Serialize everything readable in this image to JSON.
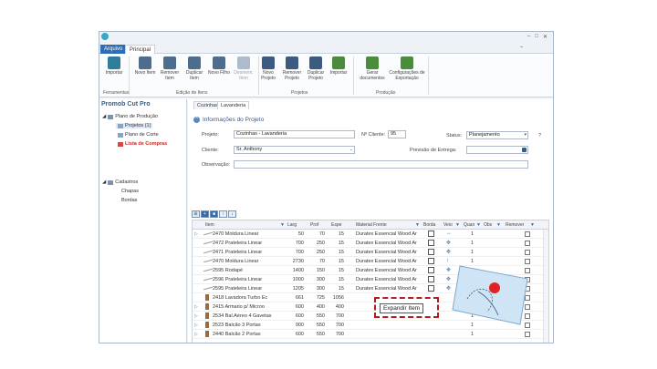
{
  "titlebar": {
    "file_tab": "Arquivo",
    "main_tab": "Principal"
  },
  "ribbon": {
    "buttons": [
      {
        "label": "Importar",
        "icon": "import-icon"
      },
      {
        "label": "Novo Item",
        "icon": "new-item-icon"
      },
      {
        "label": "Remover Item",
        "icon": "remove-item-icon"
      },
      {
        "label": "Duplicar Item",
        "icon": "duplicate-item-icon"
      },
      {
        "label": "Novo Filho",
        "icon": "new-child-icon"
      },
      {
        "label": "Desmem. Item",
        "icon": "split-item-icon"
      },
      {
        "label": "Novo Projeto",
        "icon": "new-project-icon"
      },
      {
        "label": "Remover Projeto",
        "icon": "remove-project-icon"
      },
      {
        "label": "Duplicar Projeto",
        "icon": "duplicate-project-icon"
      },
      {
        "label": "Importar",
        "icon": "import-project-icon"
      },
      {
        "label": "Gerar documentos",
        "icon": "generate-docs-icon"
      },
      {
        "label": "Configurações de Exportação",
        "icon": "export-settings-icon"
      }
    ],
    "groups": [
      "Ferramentas",
      "Edição de Itens",
      "Projetos",
      "Produção"
    ]
  },
  "left_panel": {
    "title": "Promob Cut Pro",
    "tree": {
      "plan": "Plano de Produção",
      "projects": "Projetos (1)",
      "cut_plan": "Plano de Corte",
      "shopping": "Lista de Compras",
      "registers": "Cadastros",
      "sheets": "Chapas",
      "edges": "Bordas"
    }
  },
  "main": {
    "tabs": [
      "Cozinhas",
      "Lavanderia"
    ],
    "section_title": "Informações do Projeto",
    "form": {
      "project_label": "Projeto:",
      "project_value": "Cozinhas - Lavanderia",
      "client_no_label": "Nº Cliente:",
      "client_no_value": "95",
      "status_label": "Status:",
      "status_value": "Planejamento",
      "client_label": "Cliente:",
      "client_value": "Sr. Anthony",
      "delivery_label": "Previsão de Entrega:",
      "notes_label": "Observação:",
      "help": "?"
    },
    "grid": {
      "headers": [
        "Item",
        "Larg",
        "Prof",
        "Espe",
        "Material Frente",
        "Borda",
        "Veio",
        "Quan",
        "Obs",
        "Remover"
      ],
      "rows": [
        {
          "expand": "▷",
          "icon": "line",
          "name": "2470 Moldura Linear",
          "larg": "50",
          "prof": "70",
          "espe": "15",
          "mat": "Duratex Essencial Wood Ar",
          "veio": "↔",
          "quan": "1"
        },
        {
          "expand": "",
          "icon": "line",
          "name": "2472 Prateleira Linear",
          "larg": "700",
          "prof": "250",
          "espe": "15",
          "mat": "Duratex Essencial Wood Ar",
          "veio": "✥",
          "quan": "1"
        },
        {
          "expand": "",
          "icon": "line",
          "name": "2471 Prateleira Linear",
          "larg": "700",
          "prof": "250",
          "espe": "15",
          "mat": "Duratex Essencial Wood Ar",
          "veio": "✥",
          "quan": "1"
        },
        {
          "expand": "",
          "icon": "line",
          "name": "2470 Moldura Linear",
          "larg": "2730",
          "prof": "70",
          "espe": "15",
          "mat": "Duratex Essencial Wood Ar",
          "veio": "↕",
          "quan": "1"
        },
        {
          "expand": "",
          "icon": "line",
          "name": "2595 Rodapé",
          "larg": "1400",
          "prof": "150",
          "espe": "15",
          "mat": "Duratex Essencial Wood Ar",
          "veio": "✥",
          "quan": "1"
        },
        {
          "expand": "",
          "icon": "line",
          "name": "2596 Prateleira Linear",
          "larg": "1000",
          "prof": "300",
          "espe": "15",
          "mat": "Duratex Essencial Wood Ar",
          "veio": "✥",
          "quan": "1"
        },
        {
          "expand": "",
          "icon": "line",
          "name": "2595 Prateleira Linear",
          "larg": "1205",
          "prof": "300",
          "espe": "15",
          "mat": "Duratex Essencial Wood Ar",
          "veio": "✥",
          "quan": "1"
        },
        {
          "expand": "",
          "icon": "mat",
          "name": "2418 Lavadora Turbo Ec",
          "larg": "661",
          "prof": "725",
          "espe": "1056",
          "mat": "",
          "veio": "",
          "quan": "1"
        },
        {
          "expand": "▷",
          "icon": "mat",
          "name": "2415 Armario p/ Microo",
          "larg": "600",
          "prof": "400",
          "espe": "400",
          "mat": "",
          "veio": "",
          "quan": "1"
        },
        {
          "expand": "▷",
          "icon": "mat",
          "name": "2534 Bal.Aéreo 4 Gavetas",
          "larg": "600",
          "prof": "550",
          "espe": "700",
          "mat": "",
          "veio": "",
          "quan": "1"
        },
        {
          "expand": "▷",
          "icon": "mat",
          "name": "2523 Balcão 3 Portas",
          "larg": "900",
          "prof": "550",
          "espe": "700",
          "mat": "",
          "veio": "",
          "quan": "1"
        },
        {
          "expand": "▷",
          "icon": "mat",
          "name": "2440 Balcão 2 Portas",
          "larg": "600",
          "prof": "550",
          "espe": "700",
          "mat": "",
          "veio": "",
          "quan": "1"
        }
      ]
    }
  },
  "tooltip": {
    "label": "Expandir Item"
  },
  "colors": {
    "accent": "#2f6db5",
    "callout_border": "#b51c1c",
    "dot": "#e02222"
  }
}
